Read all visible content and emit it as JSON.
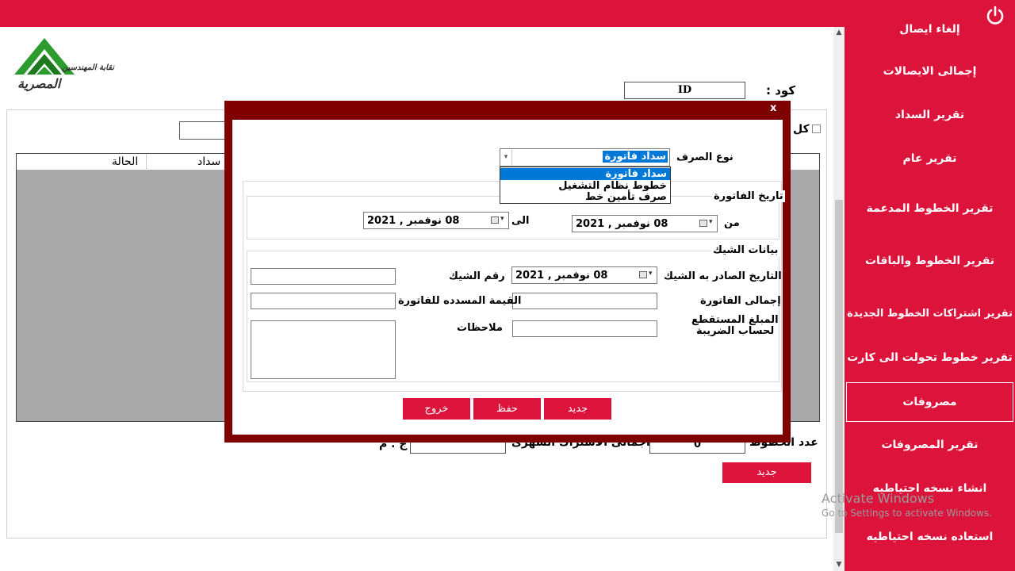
{
  "sidebar": {
    "items": [
      {
        "label": "إلغاء ايصال"
      },
      {
        "label": "إجمالى الايصالات"
      },
      {
        "label": "تقرير السداد"
      },
      {
        "label": "تقرير عام"
      },
      {
        "label": "تقرير الخطوط المدعمة"
      },
      {
        "label": "تقرير الخطوط والباقات"
      },
      {
        "label": "تقرير اشتراكات الخطوط الجديدة"
      },
      {
        "label": "تقرير خطوط تحولت الى كارت"
      },
      {
        "label": "مصروفات"
      },
      {
        "label": "تقرير المصروفات"
      },
      {
        "label": "انشاء نسخه احتياطيه"
      },
      {
        "label": "استعاده نسخه احتياطيه"
      }
    ]
  },
  "main": {
    "logo_text_top": "نقابة المهندسين",
    "logo_text_bottom": "المصرية",
    "code_label": "كود :",
    "code_value": "ID",
    "check_all_label": "كل",
    "grid": {
      "columns": [
        "الحالة",
        "سداد"
      ]
    },
    "lines_count_label": "عدد الخطوط",
    "lines_count_value": "0",
    "monthly_total_label": "اجمالى الاشتراك الشهرى",
    "currency_label": "ج . م",
    "new_button": "جديد"
  },
  "modal": {
    "close": "x",
    "expense_type_label": "نوع الصرف",
    "expense_type_selected": "سداد فاتورة",
    "expense_type_options": [
      "سداد فاتورة",
      "خطوط نظام التشغيل",
      "صرف تأمين خط"
    ],
    "invoice_date_group": "تاريخ الفاتورة",
    "from_label": "من",
    "to_label": "الى",
    "from_date": "08   نوفمبر , 2021",
    "to_date": "08   نوفمبر , 2021",
    "check_group": "بيانات الشيك",
    "check_issue_date_label": "التاريخ الصادر به الشيك",
    "check_issue_date": "08   نوفمبر , 2021",
    "check_number_label": "رقم الشيك",
    "invoice_total_label": "إجمالى الفاتورة",
    "paid_value_label": "القيمة المسدده للفاتورة",
    "tax_deducted_label_line1": "المبلغ المستقطع",
    "tax_deducted_label_line2": "لحساب الضريبة",
    "notes_label": "ملاحظات",
    "buttons": {
      "new": "جديد",
      "save": "حفظ",
      "exit": "خروج"
    }
  },
  "watermark": {
    "line1": "Activate Windows",
    "line2": "Go to Settings to activate Windows."
  },
  "colors": {
    "accent": "#dc143c",
    "modal_frame": "#7f0000",
    "selection": "#0078d7"
  },
  "icons": {
    "power": "power-icon",
    "calendar": "calendar-icon",
    "dropdown": "chevron-down-icon"
  }
}
